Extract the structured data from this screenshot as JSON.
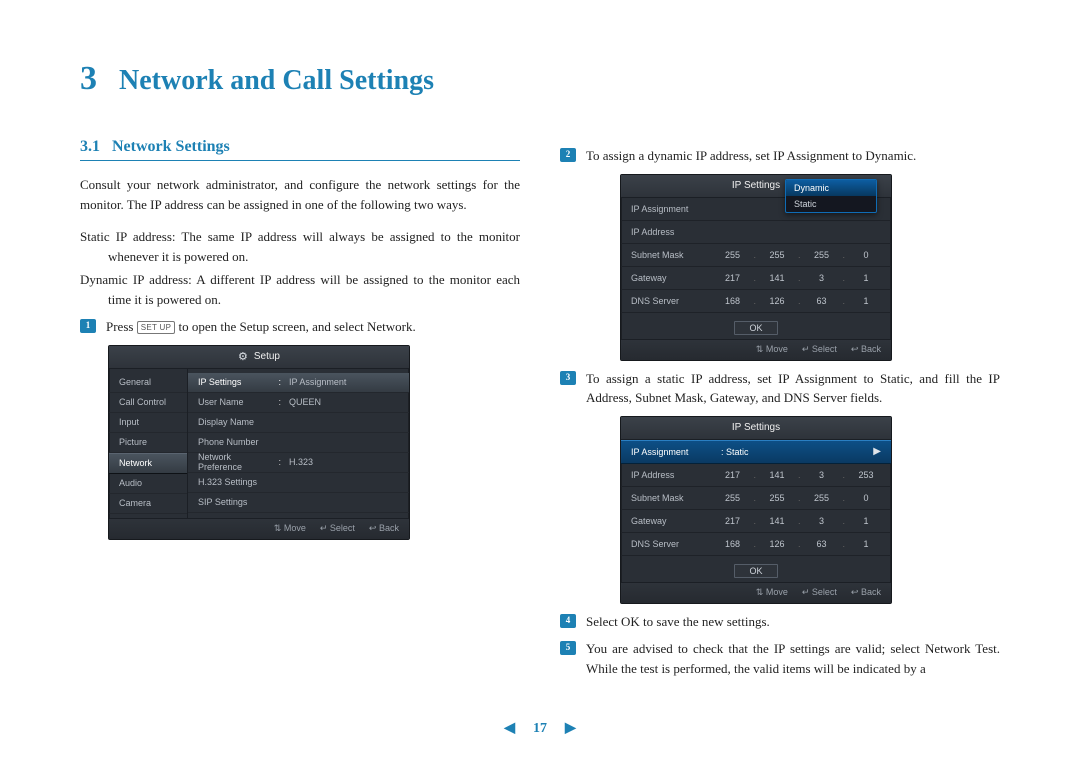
{
  "chapter": {
    "number": "3",
    "title": "Network and Call Settings"
  },
  "section": {
    "number": "3.1",
    "title": "Network Settings"
  },
  "intro": "Consult your network administrator, and configure the network settings for the monitor. The IP address can be assigned in one of the following two ways.",
  "defs": {
    "static": {
      "term": "Static IP address",
      "desc": "The same IP address will always be assigned to the monitor whenever it is powered on."
    },
    "dynamic": {
      "term": "Dynamic IP address",
      "desc": "A different IP address will be assigned to the monitor each time it is powered on."
    }
  },
  "steps": {
    "s1a": "Press ",
    "s1_key": "SET UP",
    "s1b": " to open the Setup screen, and select Network.",
    "s2": "To assign a dynamic IP address, set IP Assignment to Dynamic.",
    "s3": "To assign a static IP address, set IP Assignment to Static, and fill the IP Address, Subnet Mask, Gateway, and DNS Server fields.",
    "s4": "Select OK to save the new settings.",
    "s5": "You are advised to check that the IP settings are valid; select Network Test. While the test is performed, the valid items will be indicated by a"
  },
  "ui_setup": {
    "title": "Setup",
    "tabs": [
      "General",
      "Call Control",
      "Input",
      "Picture",
      "Network",
      "Audio",
      "Camera"
    ],
    "selected_tab_index": 4,
    "rows": [
      {
        "label": "IP Settings",
        "value": "IP Assignment"
      },
      {
        "label": "User Name",
        "value": "QUEEN"
      },
      {
        "label": "Display Name",
        "value": ""
      },
      {
        "label": "Phone Number",
        "value": ""
      },
      {
        "label": "Network Preference",
        "value": "H.323"
      },
      {
        "label": "H.323 Settings",
        "value": ""
      },
      {
        "label": "SIP Settings",
        "value": ""
      }
    ],
    "selected_row_index": 0,
    "footer": {
      "move": "Move",
      "select": "Select",
      "back": "Back"
    }
  },
  "ui_ip_dynamic": {
    "title": "IP Settings",
    "assignment_label": "IP Assignment",
    "dropdown_options": [
      "Dynamic",
      "Static"
    ],
    "dropdown_selected_index": 0,
    "rows": [
      {
        "label": "IP Address",
        "cells": [
          "",
          "",
          "",
          ""
        ]
      },
      {
        "label": "Subnet Mask",
        "cells": [
          "255",
          "255",
          "255",
          "0"
        ]
      },
      {
        "label": "Gateway",
        "cells": [
          "217",
          "141",
          "3",
          "1"
        ]
      },
      {
        "label": "DNS Server",
        "cells": [
          "168",
          "126",
          "63",
          "1"
        ]
      }
    ],
    "ok": "OK",
    "footer": {
      "move": "Move",
      "select": "Select",
      "back": "Back"
    }
  },
  "ui_ip_static": {
    "title": "IP Settings",
    "assignment_label": "IP Assignment",
    "assignment_value": "Static",
    "rows": [
      {
        "label": "IP Address",
        "cells": [
          "217",
          "141",
          "3",
          "253"
        ]
      },
      {
        "label": "Subnet Mask",
        "cells": [
          "255",
          "255",
          "255",
          "0"
        ]
      },
      {
        "label": "Gateway",
        "cells": [
          "217",
          "141",
          "3",
          "1"
        ]
      },
      {
        "label": "DNS Server",
        "cells": [
          "168",
          "126",
          "63",
          "1"
        ]
      }
    ],
    "ok": "OK",
    "footer": {
      "move": "Move",
      "select": "Select",
      "back": "Back"
    }
  },
  "page_number": "17",
  "glyphs": {
    "updown": "⇅",
    "enter": "↵",
    "left": "◀",
    "right": "▶",
    "back_arrow": "↩",
    "prev_tri": "◀",
    "next_tri": "▶",
    "gear": "⚙",
    "dot": ":"
  }
}
